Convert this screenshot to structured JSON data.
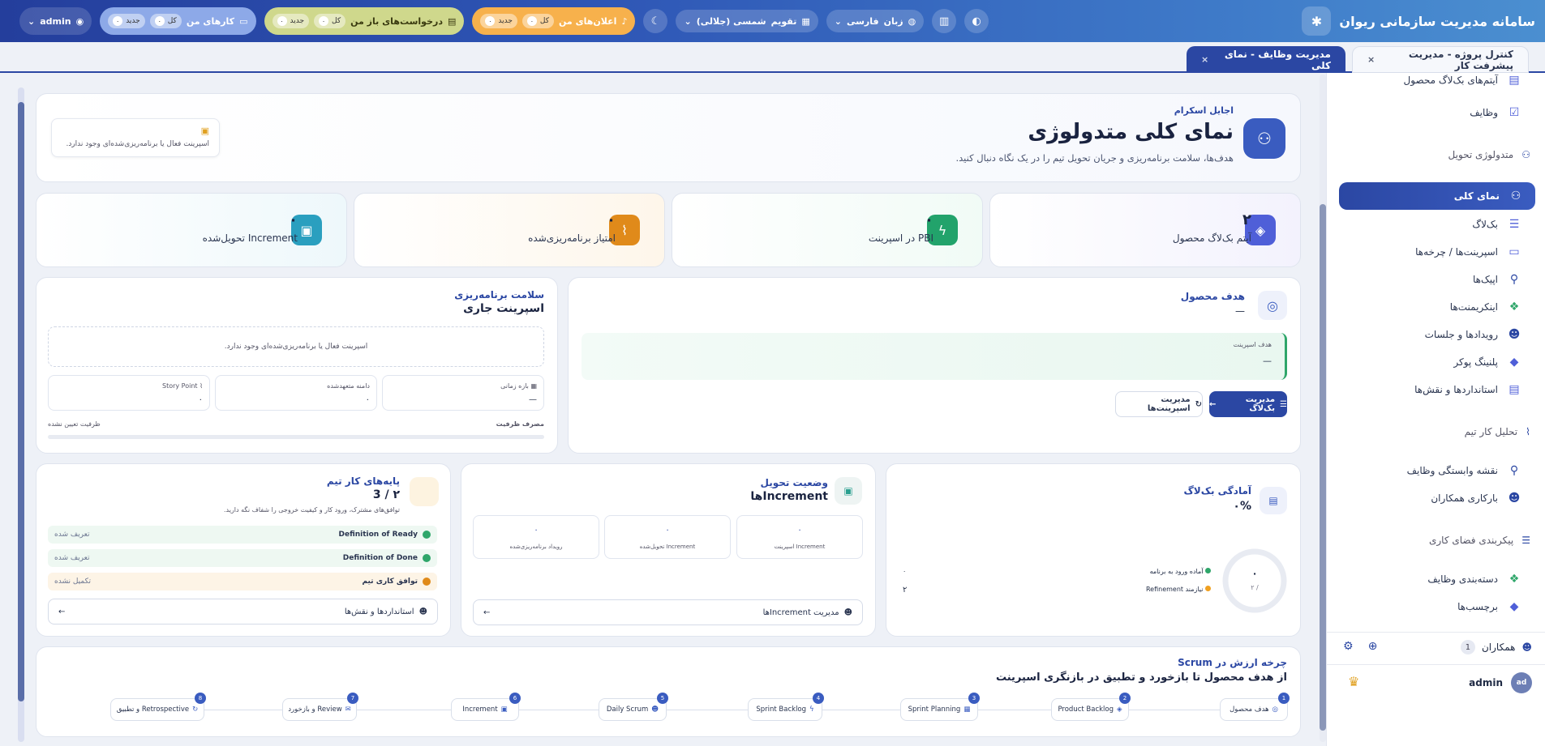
{
  "app": {
    "title": "سامانه مدیریت سازمانی ریوان"
  },
  "topbar": {
    "admin_label": "admin",
    "my_tasks": {
      "label": "کارهای من",
      "all": "کل",
      "all_count": "۰",
      "new": "جدید",
      "new_count": "۰"
    },
    "open_requests": {
      "label": "درخواست‌های باز من",
      "all": "کل",
      "all_count": "۰",
      "new": "جدید",
      "new_count": "۰"
    },
    "notifications": {
      "label": "اعلان‌های من",
      "all": "کل",
      "all_count": "۰",
      "new": "جدید",
      "new_count": "۰"
    },
    "calendar_label": "تقویم",
    "calendar_value": "شمسی (جلالی)",
    "language_label": "زبان",
    "language_value": "فارسی"
  },
  "tabs": [
    {
      "label": "کنترل پروژه - مدیریت پیشرفت کار",
      "close": "×"
    },
    {
      "label": "مدیریت وظایف - نمای کلی",
      "close": "×"
    }
  ],
  "sidebar": {
    "items_top": [
      {
        "label": "آیتم‌های بک‌لاگ محصول"
      },
      {
        "label": "وظایف"
      }
    ],
    "section_delivery": "متدولوژی تحویل",
    "delivery_items": [
      {
        "label": "نمای کلی"
      },
      {
        "label": "بک‌لاگ"
      },
      {
        "label": "اسپرینت‌ها / چرخه‌ها"
      },
      {
        "label": "اپیک‌ها"
      },
      {
        "label": "اینکریمنت‌ها"
      },
      {
        "label": "رویدادها و جلسات"
      },
      {
        "label": "پلنینگ پوکر"
      },
      {
        "label": "استانداردها و نقش‌ها"
      }
    ],
    "section_analysis": "تحلیل کار تیم",
    "analysis_items": [
      {
        "label": "نقشه وابستگی وظایف"
      },
      {
        "label": "بارکاری همکاران"
      }
    ],
    "section_workspace": "پیکربندی فضای کاری",
    "workspace_items": [
      {
        "label": "دسته‌بندی وظایف"
      },
      {
        "label": "برچسب‌ها"
      }
    ],
    "colleagues_label": "همکاران",
    "colleagues_count": "1",
    "user_name": "admin",
    "user_initials": "ad"
  },
  "hero": {
    "small": "اجایل اسکرام",
    "title": "نمای کلی متدولوژی",
    "subtitle": "هدف‌ها، سلامت برنامه‌ریزی و جریان تحویل تیم را در یک نگاه دنبال کنید.",
    "notice": "اسپرینت فعال یا برنامه‌ریزی‌شده‌ای وجود ندارد."
  },
  "stats": [
    {
      "value": "۲",
      "label": "آیتم بک‌لاگ محصول",
      "color": "#4f5fd8"
    },
    {
      "value": "۰",
      "label": "PBI در اسپرینت",
      "color": "#22a36b"
    },
    {
      "value": "۰",
      "label": "امتیاز برنامه‌ریزی‌شده",
      "color": "#e08a1a"
    },
    {
      "value": "۰",
      "label": "Increment تحویل‌شده",
      "color": "#2a9fbf"
    }
  ],
  "product_goal": {
    "title": "هدف محصول",
    "value": "—",
    "sprint_goal_label": "هدف اسپرینت",
    "sprint_goal_value": "—",
    "manage_backlog": "مدیریت بک‌لاگ",
    "manage_sprints": "مدیریت اسپرینت‌ها"
  },
  "planning_health": {
    "title": "سلامت برنامه‌ریزی",
    "subtitle": "اسپرینت جاری",
    "notice": "اسپرینت فعال یا برنامه‌ریزی‌شده‌ای وجود ندارد.",
    "time_range_label": "بازه زمانی",
    "time_range_value": "—",
    "committed_scope_label": "دامنه متعهدشده",
    "committed_scope_value": "۰",
    "story_point_label": "Story Point",
    "story_point_value": "۰",
    "capacity_label": "مصرف ظرفیت",
    "capacity_value": "ظرفیت تعیین نشده"
  },
  "backlog_ready": {
    "title": "آمادگی بک‌لاگ",
    "value": "۰%",
    "donut_main": "۰",
    "donut_sub": "/ ۲",
    "legend": [
      {
        "label": "آماده ورود به برنامه",
        "value": "۰",
        "color": "#2fa66a"
      },
      {
        "label": "نیازمند Refinement",
        "value": "۲",
        "color": "#f0a020"
      }
    ]
  },
  "delivery_status": {
    "title": "وضعیت تحویل",
    "subtitle": "Incrementها",
    "boxes": [
      {
        "value": "۰",
        "label": "Increment اسپرینت"
      },
      {
        "value": "۰",
        "label": "Increment تحویل‌شده"
      },
      {
        "value": "۰",
        "label": "رویداد برنامه‌ریزی‌شده"
      }
    ],
    "manage": "مدیریت Incrementها"
  },
  "team_foundations": {
    "title": "پایه‌های کار تیم",
    "count": "۲ / 3",
    "desc": "توافق‌های مشترک، ورود کار و کیفیت خروجی را شفاف نگه دارید.",
    "rows": [
      {
        "label": "Definition of Ready",
        "status": "تعریف شده",
        "color": "#2fa66a"
      },
      {
        "label": "Definition of Done",
        "status": "تعریف شده",
        "color": "#2fa66a"
      },
      {
        "label": "توافق کاری تیم",
        "status": "تکمیل نشده",
        "color": "#e08a1a"
      }
    ],
    "link": "استانداردها و نقش‌ها"
  },
  "value_cycle": {
    "title": "چرخه ارزش در Scrum",
    "subtitle": "از هدف محصول تا بازخورد و تطبیق در بازنگری اسپرینت",
    "steps": [
      {
        "n": "1",
        "label": "هدف محصول"
      },
      {
        "n": "2",
        "label": "Product Backlog"
      },
      {
        "n": "3",
        "label": "Sprint Planning"
      },
      {
        "n": "4",
        "label": "Sprint Backlog"
      },
      {
        "n": "5",
        "label": "Daily Scrum"
      },
      {
        "n": "6",
        "label": "Increment"
      },
      {
        "n": "7",
        "label": "Review و بازخورد"
      },
      {
        "n": "8",
        "label": "Retrospective و تطبیق"
      }
    ]
  }
}
